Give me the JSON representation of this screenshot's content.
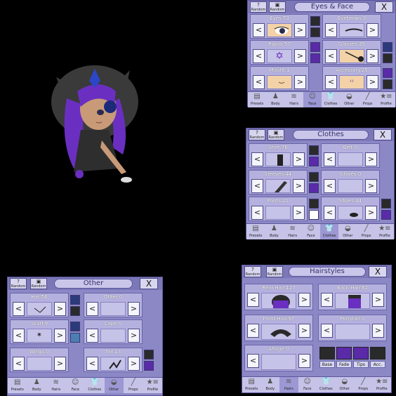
{
  "common": {
    "random_label": "Random",
    "close_label": "X",
    "left_arrow": "<",
    "right_arrow": ">"
  },
  "tab_labels": [
    "Presets",
    "Body",
    "Hairs",
    "Face",
    "Clothes",
    "Other",
    "Props",
    "Profile"
  ],
  "tab_icons": [
    "▤",
    "♟",
    "≋",
    "☺",
    "👕",
    "◒",
    "╱",
    "★≡"
  ],
  "eyes_face": {
    "title": "Eyes & Face",
    "slots": [
      "Eyes.73",
      "Eyebrows.3",
      "Pupils.57",
      "Glasses.35",
      "Mouth.1",
      "Accessory.25"
    ]
  },
  "clothes": {
    "title": "Clothes",
    "slots": [
      "Shirt.76",
      "Belt.0",
      "Sleeves.44",
      "Gloves.0",
      "Pants.21",
      "Shoes.44"
    ]
  },
  "other": {
    "title": "Other",
    "slots": [
      "Hat.56",
      "Other.0",
      "Scarf.9",
      "Cape.0",
      "Wings.0",
      "Tail.13"
    ]
  },
  "hairstyles": {
    "title": "Hairstyles",
    "slots": [
      "Rear Hair.127",
      "Back Hair.62",
      "Front Hair.97",
      "Ponytail.0",
      "Ahoge.0"
    ],
    "color_labels": [
      "Base",
      "Fade",
      "Tips",
      "Acc."
    ]
  },
  "colors": {
    "purple": "#5a2aa8",
    "dark": "#2a2a2a",
    "navy": "#2b3a7a",
    "white": "#ffffff",
    "teal": "#4a7fb4"
  }
}
